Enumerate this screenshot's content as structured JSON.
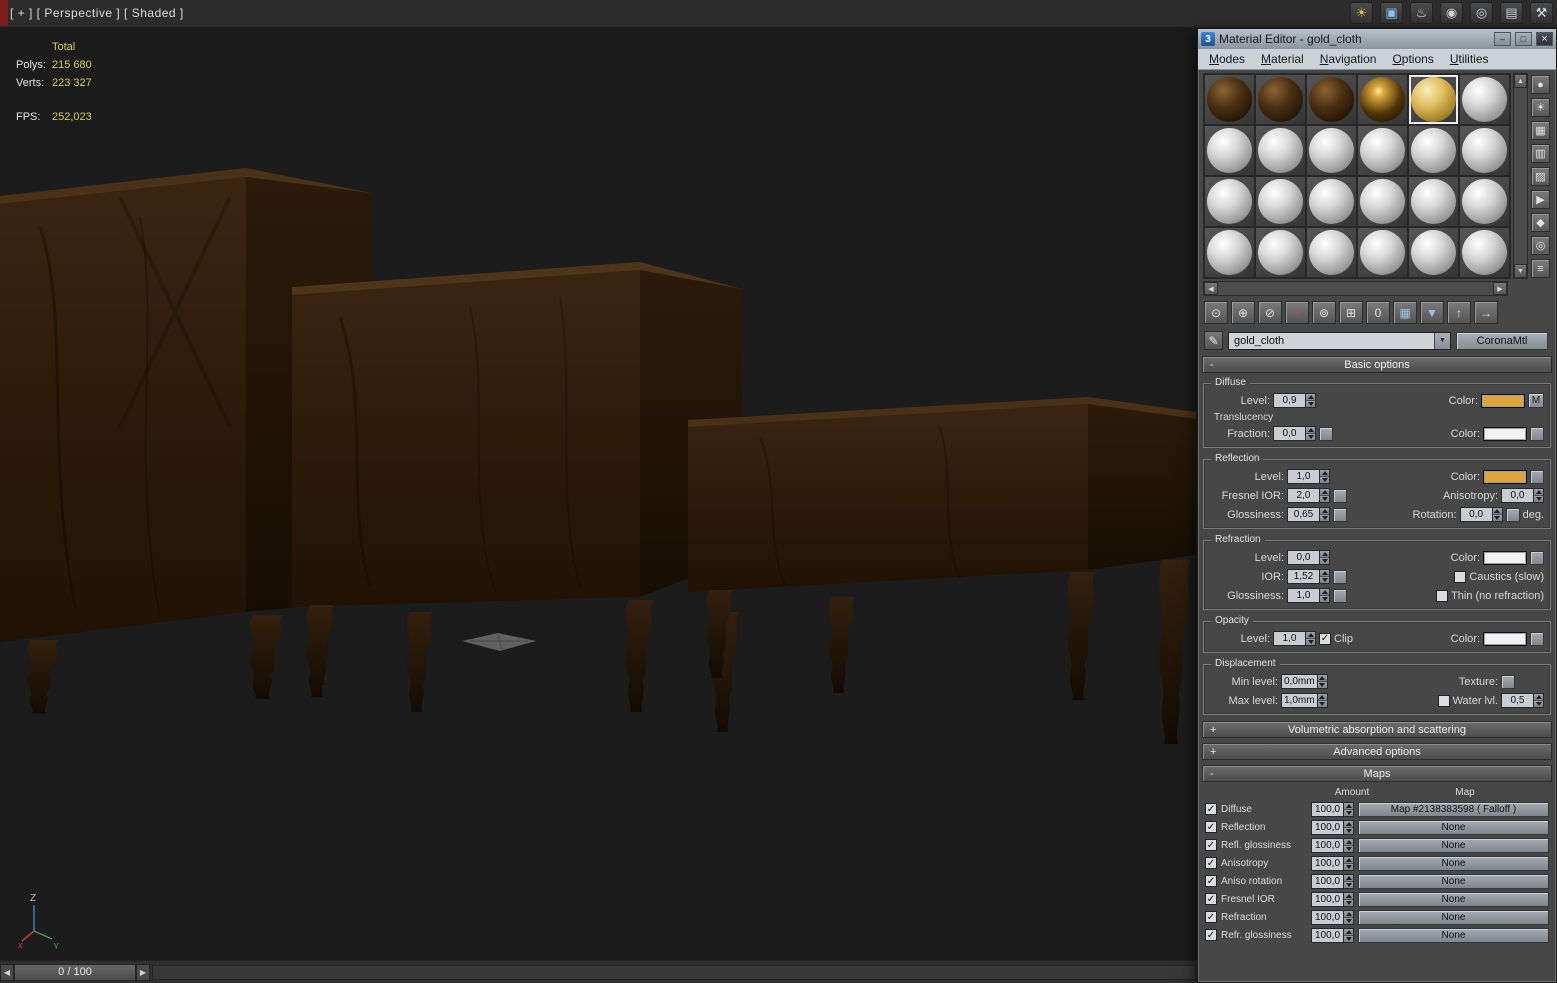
{
  "colors": {
    "gold_swatch": "#dfa43a",
    "white_swatch": "#f2f2f2"
  },
  "top_bar": {
    "viewport_label": "[ + ] [ Perspective ] [ Shaded ]"
  },
  "app_icons": [
    {
      "name": "render-flare-icon",
      "glyph": "☀",
      "fg": "#e8c23a"
    },
    {
      "name": "rendered-frame-window-icon",
      "glyph": "▣",
      "fg": "#8ec2ee"
    },
    {
      "name": "render-setup-icon",
      "glyph": "♨",
      "fg": "#d8dce0"
    },
    {
      "name": "activeshade-icon",
      "glyph": "◉",
      "fg": "#cfd3d8"
    },
    {
      "name": "render-iterative-icon",
      "glyph": "◎",
      "fg": "#cfd3d8"
    },
    {
      "name": "render-production-icon",
      "glyph": "▤",
      "fg": "#cfd3d8"
    },
    {
      "name": "utilities-hammer-icon",
      "glyph": "⚒",
      "fg": "#d8dce0"
    }
  ],
  "viewport": {
    "stats": {
      "total_label": "Total",
      "polys_label": "Polys:",
      "polys_value": "215 680",
      "verts_label": "Verts:",
      "verts_value": "223 327",
      "fps_label": "FPS:",
      "fps_value": "252,023"
    },
    "axis": {
      "z": "Z",
      "x": "x",
      "y": "y"
    }
  },
  "timeline": {
    "frame_display": "0 / 100",
    "prev_arrow": "◀",
    "next_arrow": "▶"
  },
  "material_editor": {
    "title": "Material Editor - gold_cloth",
    "logo": "3",
    "window_buttons": {
      "minimize": "–",
      "maximize": "□",
      "close": "×"
    },
    "menus": [
      "Modes",
      "Material",
      "Navigation",
      "Options",
      "Utilities"
    ],
    "slots": {
      "selected_index": 4,
      "types": [
        "dark",
        "dark",
        "dark",
        "darkspec",
        "gold",
        "gray",
        "gray",
        "gray",
        "gray",
        "gray",
        "gray",
        "gray",
        "gray",
        "gray",
        "gray",
        "gray",
        "gray",
        "gray",
        "gray",
        "gray",
        "gray",
        "gray",
        "gray",
        "gray"
      ]
    },
    "side_toolbar": [
      {
        "name": "sample-type-icon",
        "glyph": "●"
      },
      {
        "name": "backlight-icon",
        "glyph": "☀"
      },
      {
        "name": "background-icon",
        "glyph": "▦"
      },
      {
        "name": "sample-uv-tiling-icon",
        "glyph": "▥"
      },
      {
        "name": "video-color-check-icon",
        "glyph": "▨"
      },
      {
        "name": "make-preview-icon",
        "glyph": "▶"
      },
      {
        "name": "options-icon",
        "glyph": "◆"
      },
      {
        "name": "select-by-material-icon",
        "glyph": "◎"
      },
      {
        "name": "material-map-navigator-icon",
        "glyph": "≡"
      }
    ],
    "toolbar": [
      {
        "name": "get-material-icon",
        "glyph": "⊙"
      },
      {
        "name": "put-material-to-scene-icon",
        "glyph": "⊕"
      },
      {
        "name": "assign-material-to-selection-icon",
        "glyph": "⊘"
      },
      {
        "name": "reset-map-icon",
        "glyph": "×",
        "fg": "#d04038"
      },
      {
        "name": "make-material-copy-icon",
        "glyph": "⊚"
      },
      {
        "name": "put-to-library-icon",
        "glyph": "⊞"
      },
      {
        "name": "material-id-channel-icon",
        "glyph": "0"
      },
      {
        "name": "show-map-in-viewport-icon",
        "glyph": "▦",
        "fg": "#9ec4e8"
      },
      {
        "name": "show-end-result-icon",
        "glyph": "▼",
        "fg": "#9ec4e8"
      },
      {
        "name": "go-to-parent-icon",
        "glyph": "↑"
      },
      {
        "name": "go-forward-to-sibling-icon",
        "glyph": "→"
      }
    ],
    "name_row": {
      "pick_glyph": "✎",
      "material_name": "gold_cloth",
      "dropdown_arrow": "▼",
      "type_button": "CoronaMtl"
    },
    "rollouts": {
      "basic": {
        "state": "-",
        "title": "Basic options"
      },
      "volumetric": {
        "state": "+",
        "title": "Volumetric absorption and scattering"
      },
      "advanced": {
        "state": "+",
        "title": "Advanced options"
      },
      "maps": {
        "state": "-",
        "title": "Maps"
      }
    },
    "basic": {
      "diffuse": {
        "group": "Diffuse",
        "level_label": "Level:",
        "level": "0,9",
        "color_label": "Color:",
        "m_button": "M",
        "translucency_label": "Translucency",
        "fraction_label": "Fraction:",
        "fraction": "0,0",
        "t_color_label": "Color:"
      },
      "reflection": {
        "group": "Reflection",
        "level_label": "Level:",
        "level": "1,0",
        "color_label": "Color:",
        "fresnel_label": "Fresnel IOR:",
        "fresnel": "2,0",
        "aniso_label": "Anisotropy:",
        "aniso": "0,0",
        "gloss_label": "Glossiness:",
        "gloss": "0,65",
        "rotation_label": "Rotation:",
        "rotation": "0,0",
        "deg_label": "deg."
      },
      "refraction": {
        "group": "Refraction",
        "level_label": "Level:",
        "level": "0,0",
        "color_label": "Color:",
        "ior_label": "IOR:",
        "ior": "1,52",
        "caustics_label": "Caustics (slow)",
        "gloss_label": "Glossiness:",
        "gloss": "1,0",
        "thin_label": "Thin (no refraction)"
      },
      "opacity": {
        "group": "Opacity",
        "level_label": "Level:",
        "level": "1,0",
        "clip_label": "Clip",
        "color_label": "Color:"
      },
      "displacement": {
        "group": "Displacement",
        "min_label": "Min level:",
        "min": "0,0mm",
        "texture_label": "Texture:",
        "max_label": "Max level:",
        "max": "1,0mm",
        "water_label": "Water lvl.",
        "water": "0,5"
      }
    },
    "maps": {
      "amount_header": "Amount",
      "map_header": "Map",
      "rows": [
        {
          "label": "Diffuse",
          "amount": "100,0",
          "map": "Map #2138383598 ( Falloff )",
          "checked": true
        },
        {
          "label": "Reflection",
          "amount": "100,0",
          "map": "None",
          "checked": true
        },
        {
          "label": "Refl. glossiness",
          "amount": "100,0",
          "map": "None",
          "checked": true
        },
        {
          "label": "Anisotropy",
          "amount": "100,0",
          "map": "None",
          "checked": true
        },
        {
          "label": "Aniso rotation",
          "amount": "100,0",
          "map": "None",
          "checked": true
        },
        {
          "label": "Fresnel IOR",
          "amount": "100,0",
          "map": "None",
          "checked": true
        },
        {
          "label": "Refraction",
          "amount": "100,0",
          "map": "None",
          "checked": true
        },
        {
          "label": "Refr. glossiness",
          "amount": "100,0",
          "map": "None",
          "checked": true
        }
      ]
    }
  }
}
